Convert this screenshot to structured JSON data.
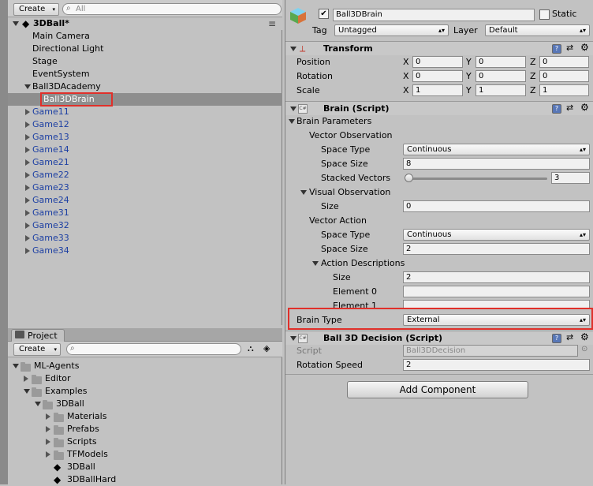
{
  "hierarchy": {
    "create_label": "Create",
    "search_placeholder": "All",
    "scene_name": "3DBall*",
    "menu_icon": "menu-icon",
    "items": [
      {
        "label": "Main Camera",
        "indent": 1,
        "blue": false,
        "expand": "none"
      },
      {
        "label": "Directional Light",
        "indent": 1,
        "blue": false,
        "expand": "none"
      },
      {
        "label": "Stage",
        "indent": 1,
        "blue": false,
        "expand": "none"
      },
      {
        "label": "EventSystem",
        "indent": 1,
        "blue": false,
        "expand": "none"
      },
      {
        "label": "Ball3DAcademy",
        "indent": 1,
        "blue": false,
        "expand": "open"
      },
      {
        "label": "Ball3DBrain",
        "indent": 2,
        "blue": false,
        "expand": "none",
        "selected": true
      },
      {
        "label": "Game11",
        "indent": 1,
        "blue": true,
        "expand": "closed"
      },
      {
        "label": "Game12",
        "indent": 1,
        "blue": true,
        "expand": "closed"
      },
      {
        "label": "Game13",
        "indent": 1,
        "blue": true,
        "expand": "closed"
      },
      {
        "label": "Game14",
        "indent": 1,
        "blue": true,
        "expand": "closed"
      },
      {
        "label": "Game21",
        "indent": 1,
        "blue": true,
        "expand": "closed"
      },
      {
        "label": "Game22",
        "indent": 1,
        "blue": true,
        "expand": "closed"
      },
      {
        "label": "Game23",
        "indent": 1,
        "blue": true,
        "expand": "closed"
      },
      {
        "label": "Game24",
        "indent": 1,
        "blue": true,
        "expand": "closed"
      },
      {
        "label": "Game31",
        "indent": 1,
        "blue": true,
        "expand": "closed"
      },
      {
        "label": "Game32",
        "indent": 1,
        "blue": true,
        "expand": "closed"
      },
      {
        "label": "Game33",
        "indent": 1,
        "blue": true,
        "expand": "closed"
      },
      {
        "label": "Game34",
        "indent": 1,
        "blue": true,
        "expand": "closed"
      }
    ]
  },
  "project": {
    "tab_label": "Project",
    "create_label": "Create",
    "tree": [
      {
        "label": "ML-Agents",
        "indent": 0,
        "expand": "open",
        "kind": "folder"
      },
      {
        "label": "Editor",
        "indent": 1,
        "expand": "closed",
        "kind": "folder"
      },
      {
        "label": "Examples",
        "indent": 1,
        "expand": "open",
        "kind": "folder"
      },
      {
        "label": "3DBall",
        "indent": 2,
        "expand": "open",
        "kind": "folder"
      },
      {
        "label": "Materials",
        "indent": 3,
        "expand": "closed",
        "kind": "folder"
      },
      {
        "label": "Prefabs",
        "indent": 3,
        "expand": "closed",
        "kind": "folder"
      },
      {
        "label": "Scripts",
        "indent": 3,
        "expand": "closed",
        "kind": "folder"
      },
      {
        "label": "TFModels",
        "indent": 3,
        "expand": "closed",
        "kind": "folder"
      },
      {
        "label": "3DBall",
        "indent": 3,
        "expand": "none",
        "kind": "scene"
      },
      {
        "label": "3DBallHard",
        "indent": 3,
        "expand": "none",
        "kind": "scene"
      }
    ]
  },
  "inspector": {
    "object_name": "Ball3DBrain",
    "active_checked": true,
    "static_label": "Static",
    "tag_label": "Tag",
    "tag_value": "Untagged",
    "layer_label": "Layer",
    "layer_value": "Default",
    "transform": {
      "title": "Transform",
      "rows": [
        {
          "label": "Position",
          "x": "0",
          "y": "0",
          "z": "0"
        },
        {
          "label": "Rotation",
          "x": "0",
          "y": "0",
          "z": "0"
        },
        {
          "label": "Scale",
          "x": "1",
          "y": "1",
          "z": "1"
        }
      ],
      "axis_labels": [
        "X",
        "Y",
        "Z"
      ]
    },
    "brain": {
      "title": "Brain (Script)",
      "params_label": "Brain Parameters",
      "vector_observation_label": "Vector Observation",
      "space_type_label": "Space Type",
      "obs_space_type": "Continuous",
      "space_size_label": "Space Size",
      "obs_space_size": "8",
      "stacked_vectors_label": "Stacked Vectors",
      "stacked_vectors_value": "3",
      "stacked_vectors_fraction": 0.02,
      "visual_observation_label": "Visual Observation",
      "size_label": "Size",
      "visual_size": "0",
      "vector_action_label": "Vector Action",
      "act_space_type": "Continuous",
      "act_space_size": "2",
      "action_descriptions_label": "Action Descriptions",
      "action_desc_size": "2",
      "element0_label": "Element 0",
      "element0_value": "",
      "element1_label": "Element 1",
      "element1_value": "",
      "brain_type_label": "Brain Type",
      "brain_type_value": "External"
    },
    "decision": {
      "title": "Ball 3D Decision (Script)",
      "script_label": "Script",
      "script_value": "Ball3DDecision",
      "rotation_speed_label": "Rotation Speed",
      "rotation_speed_value": "2"
    },
    "add_component_label": "Add Component"
  },
  "colors": {
    "highlight_red": "#e0302a",
    "prefab_blue": "#1c3fa3",
    "selection_gray": "#8e8e8e"
  }
}
